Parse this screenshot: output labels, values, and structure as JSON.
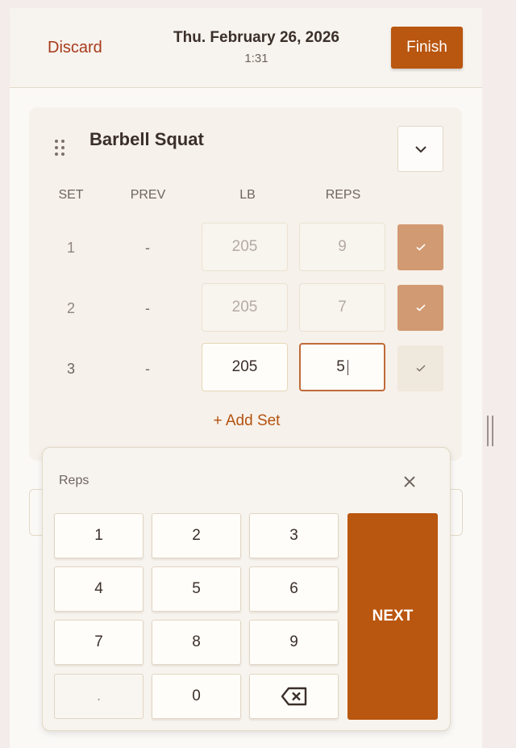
{
  "header": {
    "discard_label": "Discard",
    "date": "Thu. February 26, 2026",
    "elapsed": "1:31",
    "finish_label": "Finish"
  },
  "exercise": {
    "name": "Barbell Squat",
    "columns": {
      "set": "SET",
      "prev": "PREV",
      "weight": "LB",
      "reps": "REPS"
    },
    "sets": [
      {
        "set": "1",
        "prev": "-",
        "weight": "205",
        "reps": "9",
        "completed": true
      },
      {
        "set": "2",
        "prev": "-",
        "weight": "205",
        "reps": "7",
        "completed": true
      },
      {
        "set": "3",
        "prev": "-",
        "weight": "205",
        "reps": "5",
        "completed": false
      }
    ],
    "add_set_label": "+ Add Set"
  },
  "keypad": {
    "label": "Reps",
    "keys": [
      "1",
      "2",
      "3",
      "4",
      "5",
      "6",
      "7",
      "8",
      "9",
      ".",
      "0"
    ],
    "next_label": "NEXT"
  },
  "colors": {
    "accent": "#b9560f",
    "completed_check": "#d29a73",
    "discard": "#a73b1c"
  }
}
